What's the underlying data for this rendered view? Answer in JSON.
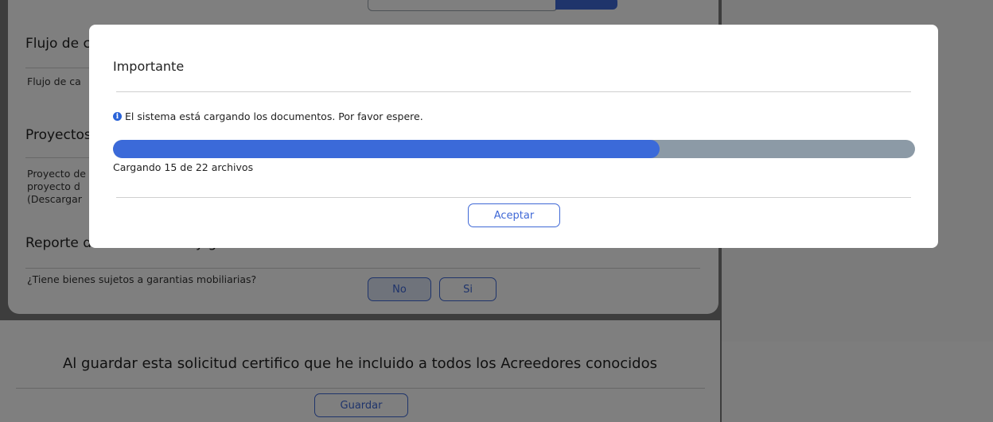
{
  "background": {
    "sections": {
      "flujo_title": "Flujo de c",
      "flujo_text": "Flujo de ca",
      "proyectos_title": "Proyectos",
      "proyectos_text_1": "Proyecto de",
      "proyectos_text_2": "proyecto d",
      "proyectos_text_3": "(Descargar",
      "reporte_title": "Reporte d",
      "reporte_title_tail": "y        g"
    },
    "question": "¿Tiene bienes sujetos a garantias mobiliarias?",
    "no_label": "No",
    "si_label": "Si",
    "certify_note": "Al guardar esta solicitud certifico que he incluido a todos los Acreedores conocidos",
    "save_label": "Guardar"
  },
  "modal": {
    "title": "Importante",
    "info_message": "El sistema está cargando los documentos. Por favor espere.",
    "info_icon": "i",
    "progress": {
      "loaded": 15,
      "total": 22,
      "label": "Cargando 15 de 22 archivos"
    },
    "accept_label": "Aceptar"
  },
  "colors": {
    "accent": "#3f68d6",
    "progress_fill": "#3b6ad9",
    "progress_track": "#8c9aa6",
    "overlay": "rgba(0,0,0,0.5)"
  }
}
